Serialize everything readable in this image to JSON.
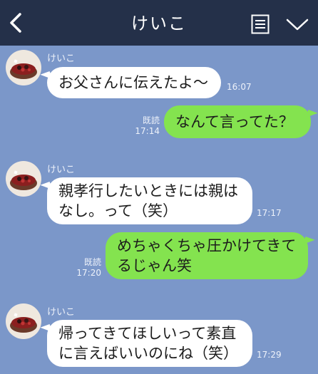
{
  "header": {
    "title": "けいこ"
  },
  "messages": [
    {
      "direction": "in",
      "sender": "けいこ",
      "lines": [
        "お父さんに伝えたよ〜"
      ],
      "time": "16:07"
    },
    {
      "direction": "out",
      "read": "既読",
      "lines": [
        "なんて言ってた？"
      ],
      "time": "17:14"
    },
    {
      "direction": "in",
      "sender": "けいこ",
      "lines": [
        "親孝行したいときには親は",
        "なし。って（笑）"
      ],
      "time": "17:17"
    },
    {
      "direction": "out",
      "read": "既読",
      "lines": [
        "めちゃくちゃ圧かけてきて",
        "るじゃん笑"
      ],
      "time": "17:20"
    },
    {
      "direction": "in",
      "sender": "けいこ",
      "lines": [
        "帰ってきてほしいって素直",
        "に言えばいいのにね（笑）"
      ],
      "time": "17:29"
    }
  ],
  "colors": {
    "background": "#7b97c9",
    "header": "#243049",
    "incoming_bubble": "#ffffff",
    "outgoing_bubble": "#84e34f"
  },
  "icons": {
    "back": "chevron-left-icon",
    "menu": "document-list-icon",
    "expand": "chevron-down-icon"
  }
}
